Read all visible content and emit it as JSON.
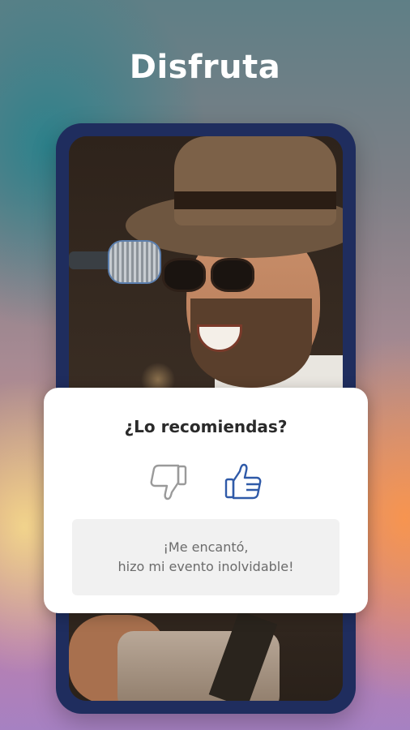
{
  "headline": "Disfruta",
  "card": {
    "question": "¿Lo recomiendas?",
    "thumbs_down_icon": "thumbs-down-icon",
    "thumbs_up_icon": "thumbs-up-icon",
    "comment_line1": "¡Me encantó,",
    "comment_line2": "hizo mi evento inolvidable!"
  },
  "colors": {
    "phone_frame": "#1f2d5e",
    "thumbs_up": "#2f5aa8",
    "thumbs_down": "#9a9a9a"
  }
}
